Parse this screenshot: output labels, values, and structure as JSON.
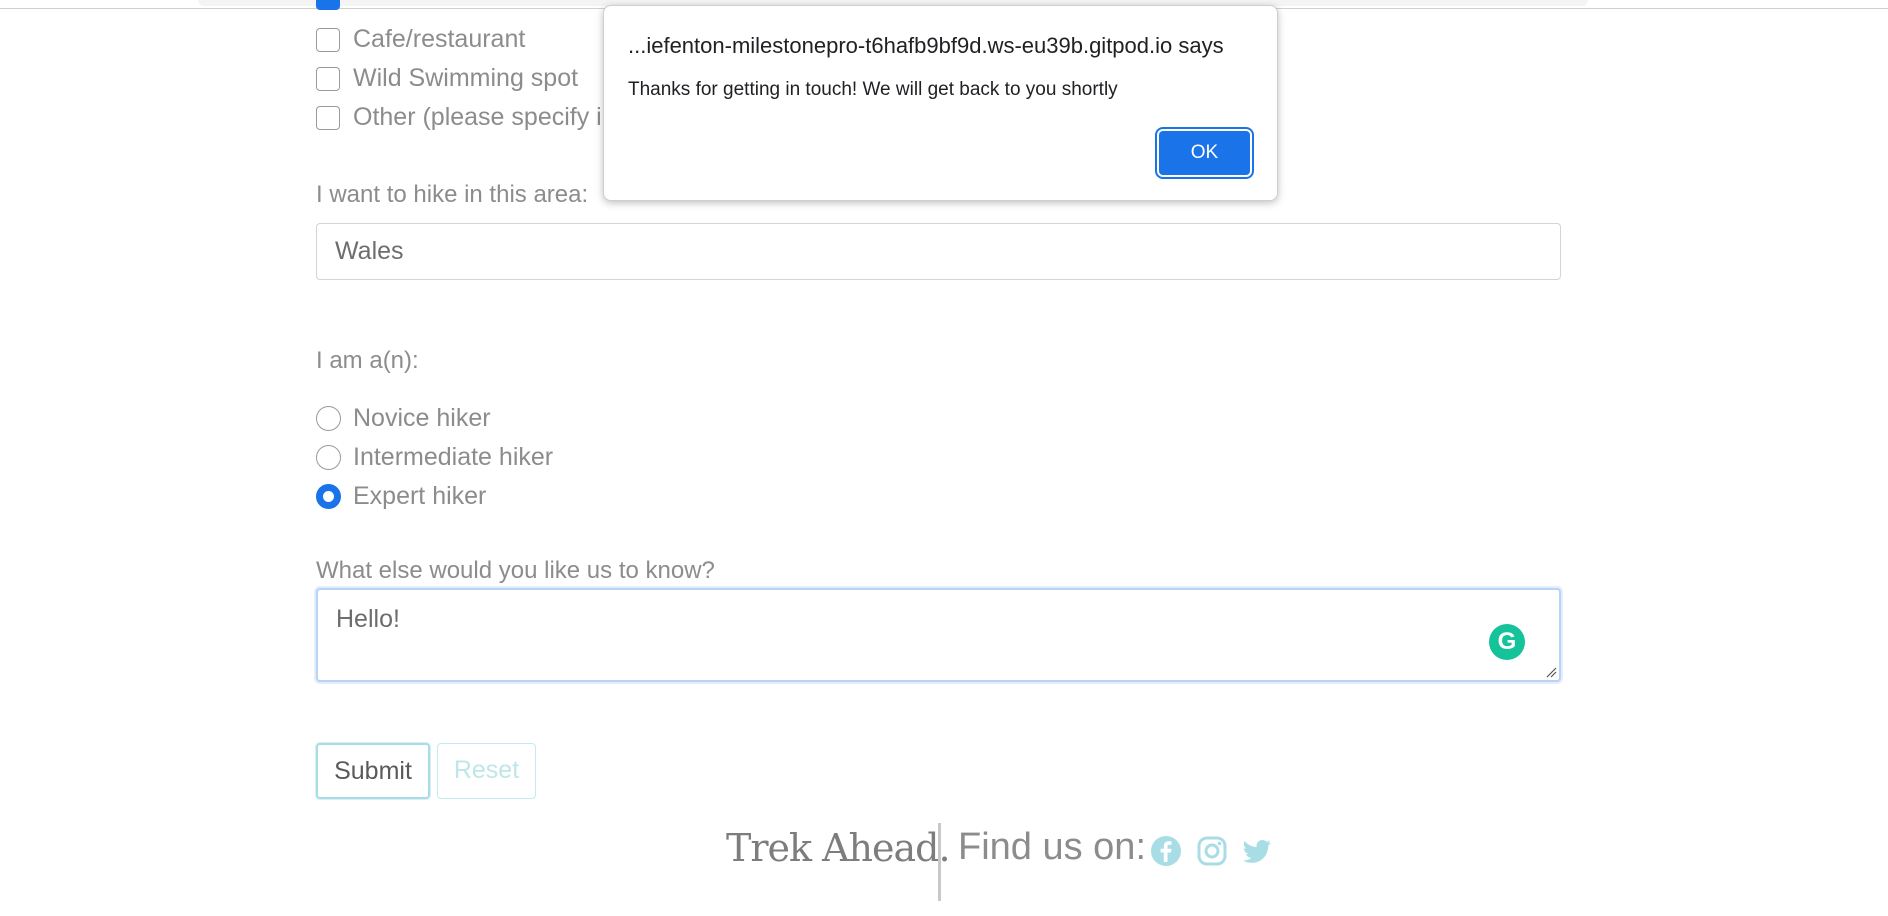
{
  "form": {
    "checkbox_options": [
      {
        "label": "",
        "checked": true
      },
      {
        "label": "Cafe/restaurant",
        "checked": false
      },
      {
        "label": "Wild Swimming spot",
        "checked": false
      },
      {
        "label": "Other (please specify in",
        "checked": false
      }
    ],
    "area_label": "I want to hike in this area:",
    "area_value": "Wales",
    "level_label": "I am a(n):",
    "level_options": [
      {
        "label": "Novice hiker",
        "checked": false
      },
      {
        "label": "Intermediate hiker",
        "checked": false
      },
      {
        "label": "Expert hiker",
        "checked": true
      }
    ],
    "message_label": "What else would you like us to know?",
    "message_value": "Hello!",
    "submit_label": "Submit",
    "reset_label": "Reset"
  },
  "footer": {
    "brand": "Trek Ahead.",
    "find_us": "Find us on:",
    "social_icons": [
      "facebook-icon",
      "instagram-icon",
      "twitter-icon"
    ],
    "icon_color": "#a9dde6"
  },
  "dialog": {
    "title": "...iefenton-milestonepro-t6hafb9bf9d.ws-eu39b.gitpod.io says",
    "message": "Thanks for getting in touch! We will get back to you shortly",
    "ok_label": "OK"
  },
  "colors": {
    "accent": "#1a73e8",
    "grammarly": "#15c39a"
  }
}
